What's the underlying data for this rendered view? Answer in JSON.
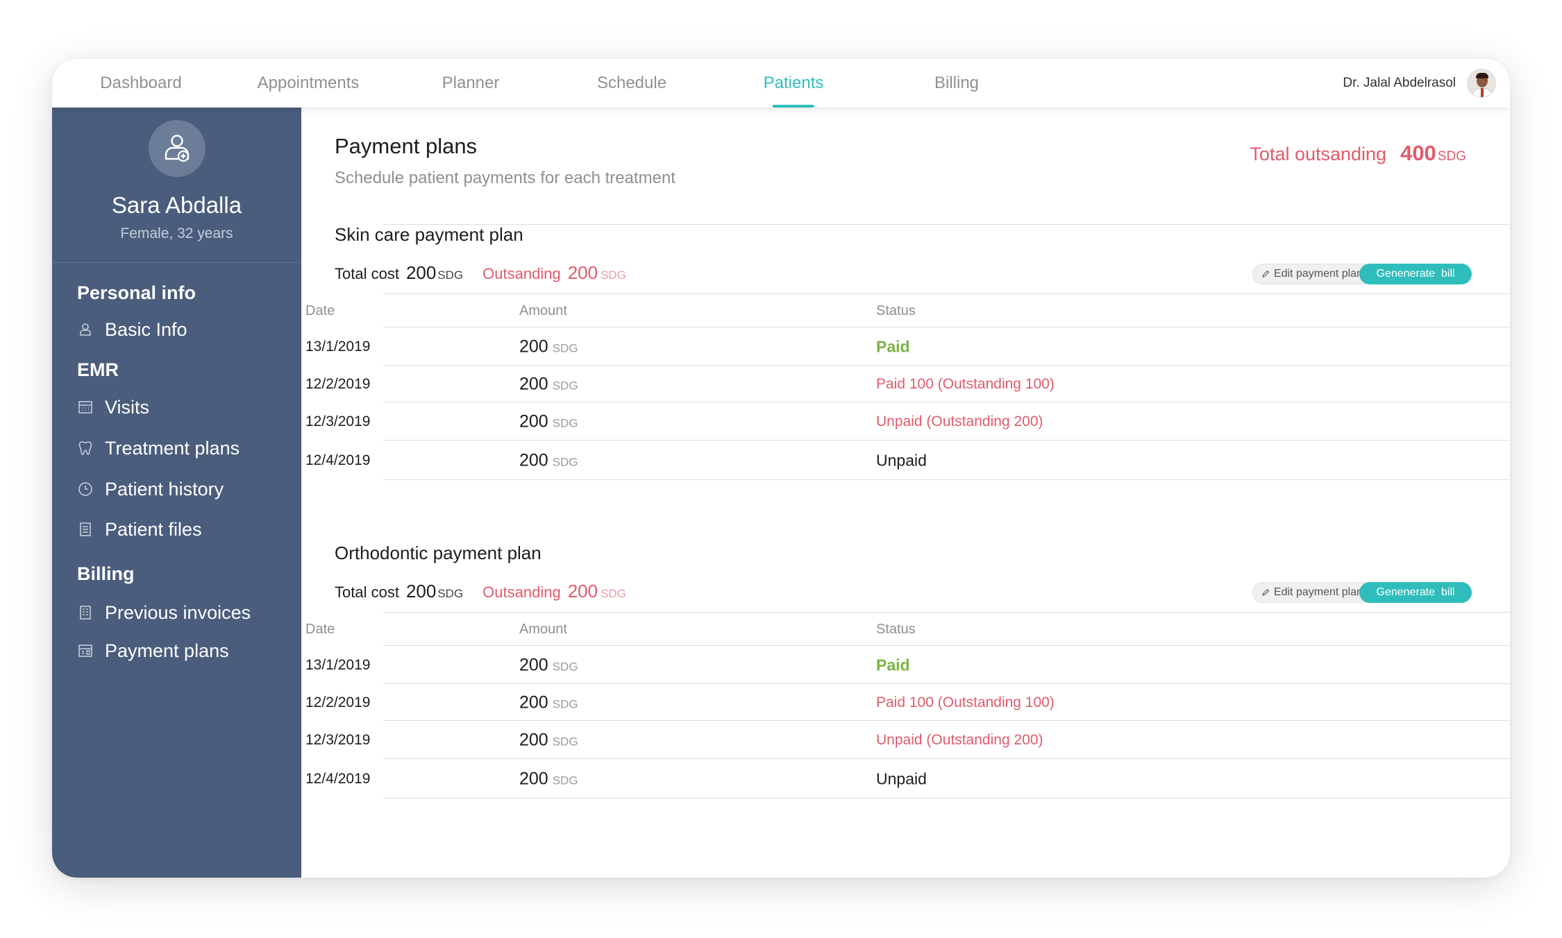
{
  "nav": {
    "tabs": [
      {
        "label": "Dashboard"
      },
      {
        "label": "Appointments"
      },
      {
        "label": "Planner"
      },
      {
        "label": "Schedule"
      },
      {
        "label": "Patients"
      },
      {
        "label": "Billing"
      }
    ],
    "active_tab": "Patients",
    "user_name": "Dr. Jalal Abdelrasol",
    "accent_color": "#2fbdbb"
  },
  "sidebar": {
    "patient_name": "Sara Abdalla",
    "patient_meta": "Female, 32 years",
    "background_color": "#4a5d7c",
    "sections": [
      {
        "heading": "Personal info",
        "items": [
          {
            "label": "Basic Info",
            "icon": "user-icon"
          }
        ]
      },
      {
        "heading": "EMR",
        "items": [
          {
            "label": "Visits",
            "icon": "calendar-icon"
          },
          {
            "label": "Treatment plans",
            "icon": "tooth-icon"
          },
          {
            "label": "Patient history",
            "icon": "clock-icon"
          },
          {
            "label": "Patient files",
            "icon": "file-icon"
          }
        ]
      },
      {
        "heading": "Billing",
        "items": [
          {
            "label": "Previous invoices",
            "icon": "invoice-icon"
          },
          {
            "label": "Payment plans",
            "icon": "payment-plan-icon"
          }
        ]
      }
    ]
  },
  "main": {
    "title": "Payment plans",
    "subtitle": "Schedule patient payments for each treatment",
    "total_outstanding_label": "Total outsanding",
    "total_outstanding_value": "400",
    "currency": "SDG",
    "edit_button_label": "Edit payment plan",
    "generate_button_label": "Genenerate  bill",
    "columns": [
      "Date",
      "Amount",
      "Status"
    ],
    "plans": [
      {
        "title": "Skin care payment plan",
        "total_cost_label": "Total cost",
        "total_cost": "200",
        "outstanding_label": "Outsanding",
        "outstanding": "200",
        "rows": [
          {
            "date": "13/1/2019",
            "amount": "200",
            "status": "Paid",
            "status_type": "paid"
          },
          {
            "date": "12/2/2019",
            "amount": "200",
            "status": "Paid 100 (Outstanding 100)",
            "status_type": "partial"
          },
          {
            "date": "12/3/2019",
            "amount": "200",
            "status": "Unpaid (Outstanding 200)",
            "status_type": "unpaid-out"
          },
          {
            "date": "12/4/2019",
            "amount": "200",
            "status": "Unpaid",
            "status_type": "unpaid"
          }
        ]
      },
      {
        "title": "Orthodontic payment plan",
        "total_cost_label": "Total cost",
        "total_cost": "200",
        "outstanding_label": "Outsanding",
        "outstanding": "200",
        "rows": [
          {
            "date": "13/1/2019",
            "amount": "200",
            "status": "Paid",
            "status_type": "paid"
          },
          {
            "date": "12/2/2019",
            "amount": "200",
            "status": "Paid 100 (Outstanding 100)",
            "status_type": "partial"
          },
          {
            "date": "12/3/2019",
            "amount": "200",
            "status": "Unpaid (Outstanding 200)",
            "status_type": "unpaid-out"
          },
          {
            "date": "12/4/2019",
            "amount": "200",
            "status": "Unpaid",
            "status_type": "unpaid"
          }
        ]
      }
    ]
  },
  "status_colors": {
    "paid": "#7cb342",
    "outstanding": "#e25a6b",
    "unpaid": "#1c1c1c"
  }
}
